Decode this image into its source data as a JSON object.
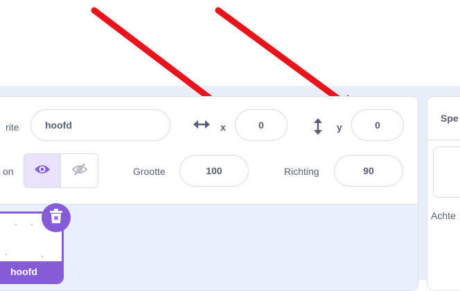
{
  "sprite_info": {
    "sprite_label": "rite",
    "sprite_name": "hoofd",
    "x_label": "x",
    "x_value": "0",
    "y_label": "y",
    "y_value": "0",
    "show_label": "on",
    "size_label": "Grootte",
    "size_value": "100",
    "direction_label": "Richting",
    "direction_value": "90"
  },
  "sprite_list": {
    "items": [
      {
        "name": "hoofd"
      }
    ]
  },
  "stage_panel": {
    "tab_label": "Spe",
    "backdrops_label": "Achte"
  },
  "colors": {
    "accent": "#855cd6",
    "arrow": "#e8141b",
    "text": "#575e75",
    "panel_bg": "#e9f0fb"
  }
}
